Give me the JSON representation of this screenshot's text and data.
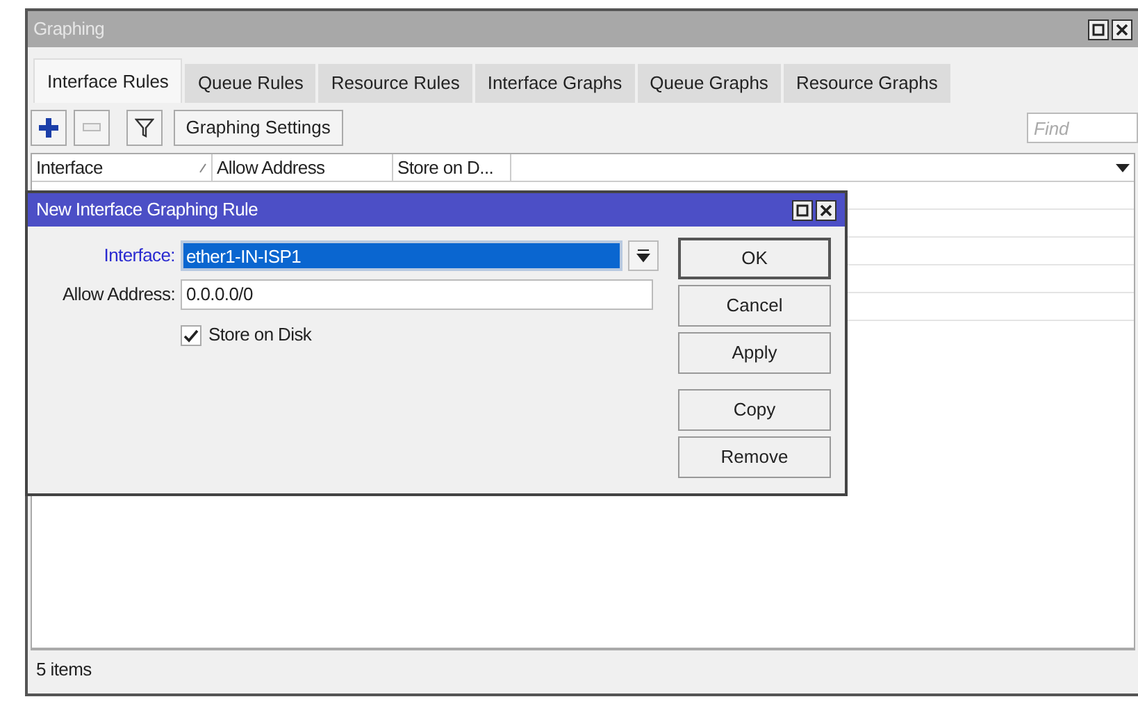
{
  "window": {
    "title": "Graphing"
  },
  "tabs": [
    {
      "label": "Interface Rules",
      "selected": true
    },
    {
      "label": "Queue Rules",
      "selected": false
    },
    {
      "label": "Resource Rules",
      "selected": false
    },
    {
      "label": "Interface Graphs",
      "selected": false
    },
    {
      "label": "Queue Graphs",
      "selected": false
    },
    {
      "label": "Resource Graphs",
      "selected": false
    }
  ],
  "toolbar": {
    "settings_button": "Graphing Settings",
    "find": {
      "placeholder": "Find"
    }
  },
  "table": {
    "columns": [
      "Interface",
      "Allow Address",
      "Store on D..."
    ]
  },
  "status_bar": "5 items",
  "dialog": {
    "title": "New Interface Graphing Rule",
    "fields": [
      {
        "label": "Interface:",
        "value": "ether1-IN-ISP1",
        "kind": "dropdown",
        "focused": true
      },
      {
        "label": "Allow Address:",
        "value": "0.0.0.0/0",
        "kind": "text",
        "focused": false
      }
    ],
    "checkbox": {
      "label": "Store on Disk",
      "checked": true
    },
    "buttons": [
      {
        "label": "OK",
        "default": true
      },
      {
        "label": "Cancel",
        "default": false
      },
      {
        "label": "Apply",
        "default": false
      },
      {
        "label": "Copy",
        "default": false
      },
      {
        "label": "Remove",
        "default": false
      }
    ]
  }
}
